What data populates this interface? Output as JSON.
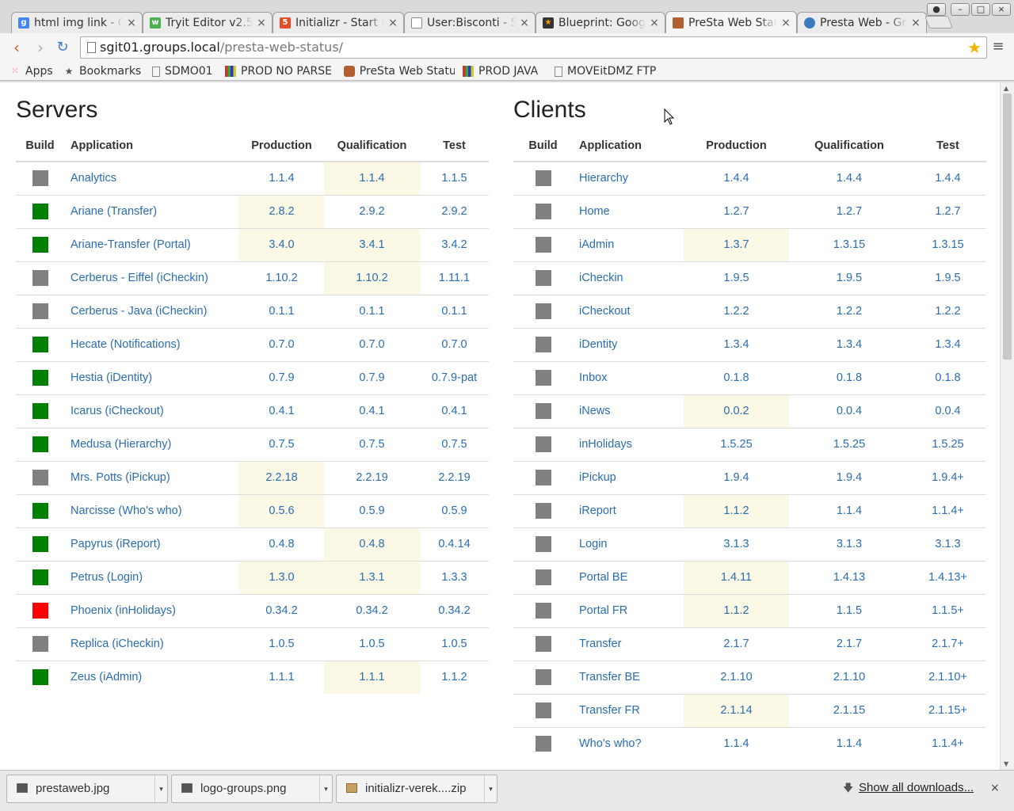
{
  "browser": {
    "tabs": [
      {
        "title": "html img link - G",
        "icon": "google-icon",
        "active": false
      },
      {
        "title": "Tryit Editor v2.5",
        "icon": "w3schools-icon",
        "active": false
      },
      {
        "title": "Initializr - Start a",
        "icon": "html5-icon",
        "active": false
      },
      {
        "title": "User:Bisconti - S",
        "icon": "document-icon",
        "active": false
      },
      {
        "title": "Blueprint: Goog",
        "icon": "blueprint-icon",
        "active": false
      },
      {
        "title": "PreSta Web Stat",
        "icon": "presta-icon",
        "active": true
      },
      {
        "title": "Presta Web - Gro",
        "icon": "groups-icon",
        "active": false
      }
    ],
    "url_host": "sgit01.groups.local",
    "url_path": "/presta-web-status/",
    "bookmarks": [
      {
        "label": "Apps",
        "icon": "apps-grid-icon"
      },
      {
        "label": "Bookmarks",
        "icon": "star-icon"
      },
      {
        "label": "SDMO01",
        "icon": "document-icon"
      },
      {
        "label": "PROD NO PARSE",
        "icon": "stripes-icon"
      },
      {
        "label": "PreSta Web Statu",
        "icon": "presta-icon"
      },
      {
        "label": "PROD JAVA",
        "icon": "stripes-icon"
      },
      {
        "label": "MOVEitDMZ FTP",
        "icon": "document-icon"
      }
    ]
  },
  "colors": {
    "build_green": "#008000",
    "build_gray": "#808080",
    "build_red": "#ff0000",
    "highlight": "#fcf8e6",
    "link": "#2a6db0"
  },
  "servers": {
    "title": "Servers",
    "headers": {
      "build": "Build",
      "application": "Application",
      "production": "Production",
      "qualification": "Qualification",
      "test": "Test"
    },
    "rows": [
      {
        "build": "gray",
        "app": "Analytics",
        "prod": "1.1.4",
        "qual": "1.1.4",
        "test": "1.1.5",
        "hl": [
          false,
          true,
          false
        ]
      },
      {
        "build": "green",
        "app": "Ariane (Transfer)",
        "prod": "2.8.2",
        "qual": "2.9.2",
        "test": "2.9.2",
        "hl": [
          true,
          false,
          false
        ]
      },
      {
        "build": "green",
        "app": "Ariane-Transfer (Portal)",
        "prod": "3.4.0",
        "qual": "3.4.1",
        "test": "3.4.2",
        "hl": [
          true,
          true,
          false
        ]
      },
      {
        "build": "gray",
        "app": "Cerberus - Eiffel (iCheckin)",
        "prod": "1.10.2",
        "qual": "1.10.2",
        "test": "1.11.1",
        "hl": [
          false,
          true,
          false
        ]
      },
      {
        "build": "gray",
        "app": "Cerberus - Java (iCheckin)",
        "prod": "0.1.1",
        "qual": "0.1.1",
        "test": "0.1.1",
        "hl": [
          false,
          false,
          false
        ]
      },
      {
        "build": "green",
        "app": "Hecate (Notifications)",
        "prod": "0.7.0",
        "qual": "0.7.0",
        "test": "0.7.0",
        "hl": [
          false,
          false,
          false
        ]
      },
      {
        "build": "green",
        "app": "Hestia (iDentity)",
        "prod": "0.7.9",
        "qual": "0.7.9",
        "test": "0.7.9-pat",
        "hl": [
          false,
          false,
          false
        ]
      },
      {
        "build": "green",
        "app": "Icarus (iCheckout)",
        "prod": "0.4.1",
        "qual": "0.4.1",
        "test": "0.4.1",
        "hl": [
          false,
          false,
          false
        ]
      },
      {
        "build": "green",
        "app": "Medusa (Hierarchy)",
        "prod": "0.7.5",
        "qual": "0.7.5",
        "test": "0.7.5",
        "hl": [
          false,
          false,
          false
        ]
      },
      {
        "build": "gray",
        "app": "Mrs. Potts (iPickup)",
        "prod": "2.2.18",
        "qual": "2.2.19",
        "test": "2.2.19",
        "hl": [
          true,
          false,
          false
        ]
      },
      {
        "build": "green",
        "app": "Narcisse (Who's who)",
        "prod": "0.5.6",
        "qual": "0.5.9",
        "test": "0.5.9",
        "hl": [
          true,
          false,
          false
        ]
      },
      {
        "build": "green",
        "app": "Papyrus (iReport)",
        "prod": "0.4.8",
        "qual": "0.4.8",
        "test": "0.4.14",
        "hl": [
          false,
          true,
          false
        ]
      },
      {
        "build": "green",
        "app": "Petrus (Login)",
        "prod": "1.3.0",
        "qual": "1.3.1",
        "test": "1.3.3",
        "hl": [
          true,
          true,
          false
        ]
      },
      {
        "build": "red",
        "app": "Phoenix (inHolidays)",
        "prod": "0.34.2",
        "qual": "0.34.2",
        "test": "0.34.2",
        "hl": [
          false,
          false,
          false
        ]
      },
      {
        "build": "gray",
        "app": "Replica (iCheckin)",
        "prod": "1.0.5",
        "qual": "1.0.5",
        "test": "1.0.5",
        "hl": [
          false,
          false,
          false
        ]
      },
      {
        "build": "green",
        "app": "Zeus (iAdmin)",
        "prod": "1.1.1",
        "qual": "1.1.1",
        "test": "1.1.2",
        "hl": [
          false,
          true,
          false
        ]
      }
    ]
  },
  "clients": {
    "title": "Clients",
    "headers": {
      "build": "Build",
      "application": "Application",
      "production": "Production",
      "qualification": "Qualification",
      "test": "Test"
    },
    "rows": [
      {
        "build": "gray",
        "app": "Hierarchy",
        "prod": "1.4.4",
        "qual": "1.4.4",
        "test": "1.4.4",
        "hl": [
          false,
          false,
          false
        ]
      },
      {
        "build": "gray",
        "app": "Home",
        "prod": "1.2.7",
        "qual": "1.2.7",
        "test": "1.2.7",
        "hl": [
          false,
          false,
          false
        ]
      },
      {
        "build": "gray",
        "app": "iAdmin",
        "prod": "1.3.7",
        "qual": "1.3.15",
        "test": "1.3.15",
        "hl": [
          true,
          false,
          false
        ]
      },
      {
        "build": "gray",
        "app": "iCheckin",
        "prod": "1.9.5",
        "qual": "1.9.5",
        "test": "1.9.5",
        "hl": [
          false,
          false,
          false
        ]
      },
      {
        "build": "gray",
        "app": "iCheckout",
        "prod": "1.2.2",
        "qual": "1.2.2",
        "test": "1.2.2",
        "hl": [
          false,
          false,
          false
        ]
      },
      {
        "build": "gray",
        "app": "iDentity",
        "prod": "1.3.4",
        "qual": "1.3.4",
        "test": "1.3.4",
        "hl": [
          false,
          false,
          false
        ]
      },
      {
        "build": "gray",
        "app": "Inbox",
        "prod": "0.1.8",
        "qual": "0.1.8",
        "test": "0.1.8",
        "hl": [
          false,
          false,
          false
        ]
      },
      {
        "build": "gray",
        "app": "iNews",
        "prod": "0.0.2",
        "qual": "0.0.4",
        "test": "0.0.4",
        "hl": [
          true,
          false,
          false
        ]
      },
      {
        "build": "gray",
        "app": "inHolidays",
        "prod": "1.5.25",
        "qual": "1.5.25",
        "test": "1.5.25",
        "hl": [
          false,
          false,
          false
        ]
      },
      {
        "build": "gray",
        "app": "iPickup",
        "prod": "1.9.4",
        "qual": "1.9.4",
        "test": "1.9.4+",
        "hl": [
          false,
          false,
          false
        ]
      },
      {
        "build": "gray",
        "app": "iReport",
        "prod": "1.1.2",
        "qual": "1.1.4",
        "test": "1.1.4+",
        "hl": [
          true,
          false,
          false
        ]
      },
      {
        "build": "gray",
        "app": "Login",
        "prod": "3.1.3",
        "qual": "3.1.3",
        "test": "3.1.3",
        "hl": [
          false,
          false,
          false
        ]
      },
      {
        "build": "gray",
        "app": "Portal BE",
        "prod": "1.4.11",
        "qual": "1.4.13",
        "test": "1.4.13+",
        "hl": [
          true,
          false,
          false
        ]
      },
      {
        "build": "gray",
        "app": "Portal FR",
        "prod": "1.1.2",
        "qual": "1.1.5",
        "test": "1.1.5+",
        "hl": [
          true,
          false,
          false
        ]
      },
      {
        "build": "gray",
        "app": "Transfer",
        "prod": "2.1.7",
        "qual": "2.1.7",
        "test": "2.1.7+",
        "hl": [
          false,
          false,
          false
        ]
      },
      {
        "build": "gray",
        "app": "Transfer BE",
        "prod": "2.1.10",
        "qual": "2.1.10",
        "test": "2.1.10+",
        "hl": [
          false,
          false,
          false
        ]
      },
      {
        "build": "gray",
        "app": "Transfer FR",
        "prod": "2.1.14",
        "qual": "2.1.15",
        "test": "2.1.15+",
        "hl": [
          true,
          false,
          false
        ]
      },
      {
        "build": "gray",
        "app": "Who's who?",
        "prod": "1.1.4",
        "qual": "1.1.4",
        "test": "1.1.4+",
        "hl": [
          false,
          false,
          false
        ]
      }
    ]
  },
  "downloads": {
    "items": [
      {
        "name": "prestaweb.jpg",
        "icon": "image-file-icon"
      },
      {
        "name": "logo-groups.png",
        "icon": "image-file-icon"
      },
      {
        "name": "initializr-verek....zip",
        "icon": "archive-file-icon"
      }
    ],
    "show_all": "Show all downloads...",
    "close": "×"
  }
}
